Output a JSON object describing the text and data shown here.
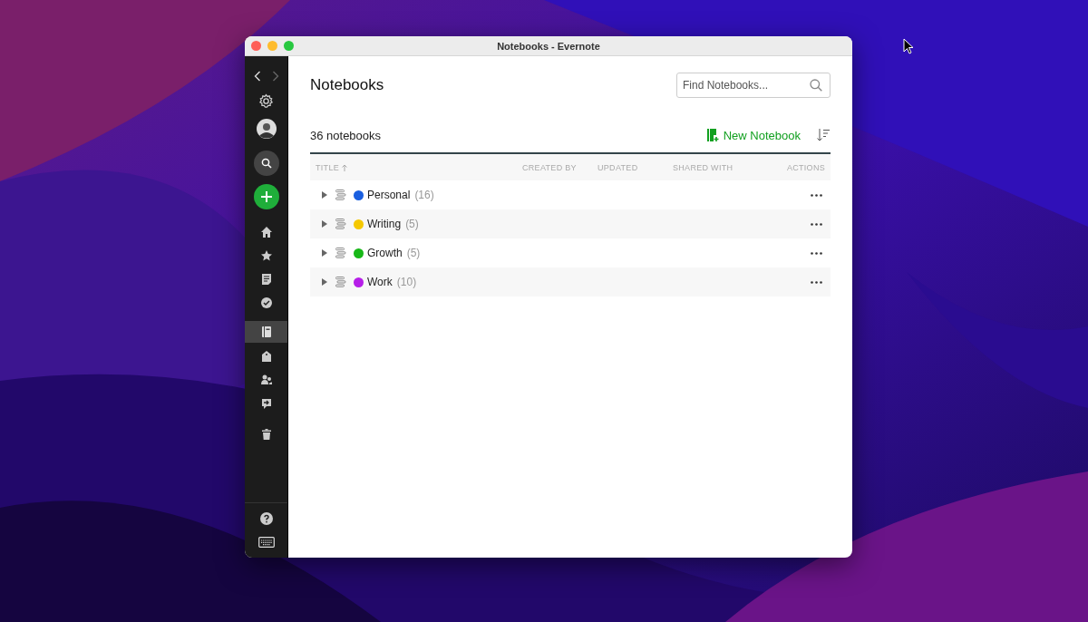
{
  "window": {
    "title": "Notebooks - Evernote"
  },
  "sidebar": {
    "nav_items": [
      {
        "kind": "home",
        "selected": false
      },
      {
        "kind": "star",
        "selected": false
      },
      {
        "kind": "note",
        "selected": false
      },
      {
        "kind": "task",
        "selected": false
      },
      {
        "kind": "notebook",
        "selected": true
      },
      {
        "kind": "tag",
        "selected": false
      },
      {
        "kind": "people",
        "selected": false
      },
      {
        "kind": "shared",
        "selected": false
      },
      {
        "kind": "trash",
        "selected": false
      }
    ]
  },
  "page": {
    "title": "Notebooks",
    "search": {
      "placeholder": "Find Notebooks..."
    },
    "count": "36 notebooks",
    "new_button": "New Notebook"
  },
  "table": {
    "columns": [
      "TITLE",
      "CREATED BY",
      "UPDATED",
      "SHARED WITH",
      "ACTIONS"
    ],
    "rows": [
      {
        "name": "Personal",
        "count": "(16)",
        "color": "#1a5fe0"
      },
      {
        "name": "Writing",
        "count": "(5)",
        "color": "#f5c800"
      },
      {
        "name": "Growth",
        "count": "(5)",
        "color": "#18b818"
      },
      {
        "name": "Work",
        "count": "(10)",
        "color": "#b61ee8"
      }
    ]
  }
}
